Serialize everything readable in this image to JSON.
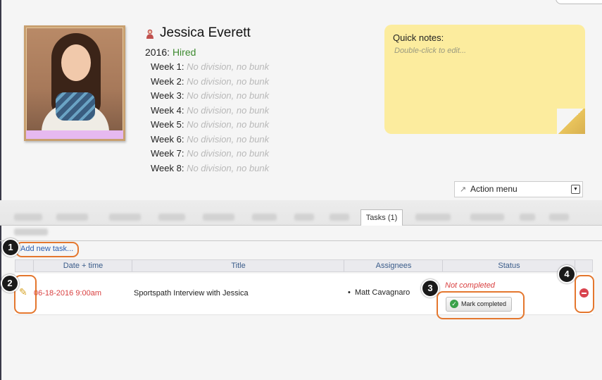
{
  "profile": {
    "name": "Jessica Everett",
    "year": "2016:",
    "status": "Hired",
    "weeks": [
      {
        "label": "Week 1:",
        "value": "No division, no bunk"
      },
      {
        "label": "Week 2:",
        "value": "No division, no bunk"
      },
      {
        "label": "Week 3:",
        "value": "No division, no bunk"
      },
      {
        "label": "Week 4:",
        "value": "No division, no bunk"
      },
      {
        "label": "Week 5:",
        "value": "No division, no bunk"
      },
      {
        "label": "Week 6:",
        "value": "No division, no bunk"
      },
      {
        "label": "Week 7:",
        "value": "No division, no bunk"
      },
      {
        "label": "Week 8:",
        "value": "No division, no bunk"
      }
    ]
  },
  "notes": {
    "title": "Quick notes:",
    "hint": "Double-click to edit..."
  },
  "action_menu": {
    "label": "Action menu"
  },
  "tabs": {
    "active": "Tasks (1)"
  },
  "tasks": {
    "add_label": "Add new task...",
    "columns": [
      "Date + time",
      "Title",
      "Assignees",
      "Status"
    ],
    "row": {
      "date": "06-18-2016 9:00am",
      "title": "Sportspath Interview with Jessica",
      "assignee": "Matt Cavagnaro",
      "status": "Not completed",
      "mark_label": "Mark completed"
    }
  },
  "callouts": [
    "1",
    "2",
    "3",
    "4"
  ],
  "colors": {
    "highlight": "#e4772e",
    "hired": "#3d8a2f",
    "danger": "#d94040",
    "link": "#2a5db0"
  }
}
